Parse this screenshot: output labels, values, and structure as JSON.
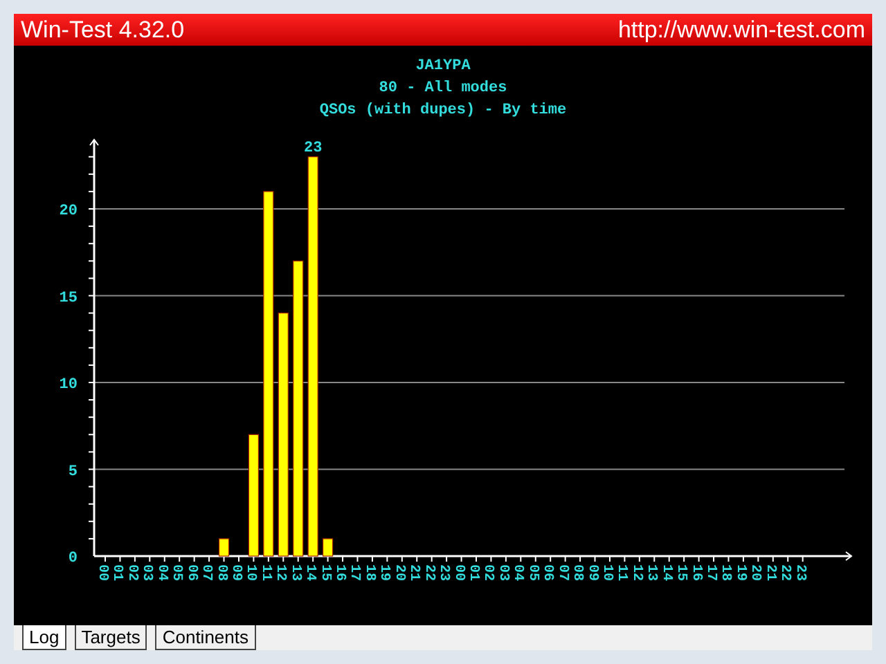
{
  "window": {
    "title": "Win-Test 4.32.0",
    "url": "http://www.win-test.com"
  },
  "chart": {
    "titles": [
      "JA1YPA",
      "80 - All modes",
      "QSOs (with dupes) - By time"
    ],
    "chart_data": {
      "type": "bar",
      "grid": true,
      "categories": [
        "00",
        "01",
        "02",
        "03",
        "04",
        "05",
        "06",
        "07",
        "08",
        "09",
        "10",
        "11",
        "12",
        "13",
        "14",
        "15",
        "16",
        "17",
        "18",
        "19",
        "20",
        "21",
        "22",
        "23",
        "00",
        "01",
        "02",
        "03",
        "04",
        "05",
        "06",
        "07",
        "08",
        "09",
        "10",
        "11",
        "12",
        "13",
        "14",
        "15",
        "16",
        "17",
        "18",
        "19",
        "20",
        "21",
        "22",
        "23"
      ],
      "series": [
        {
          "color": "#ffff00",
          "values": [
            0,
            0,
            0,
            0,
            0,
            0,
            0,
            0,
            1,
            0,
            7,
            21,
            14,
            17,
            23,
            1,
            0,
            0,
            0,
            0,
            0,
            0,
            0,
            0,
            0,
            0,
            0,
            0,
            0,
            0,
            0,
            0,
            0,
            0,
            0,
            0,
            0,
            0,
            0,
            0,
            0,
            0,
            0,
            0,
            0,
            0,
            0,
            0
          ]
        }
      ],
      "ylim": [
        0,
        24
      ],
      "yticks": [
        0,
        5,
        10,
        15,
        20
      ],
      "value_labels": [
        null,
        null,
        null,
        null,
        null,
        null,
        null,
        null,
        null,
        null,
        null,
        null,
        null,
        null,
        "23",
        null,
        null,
        null,
        null,
        null,
        null,
        null,
        null,
        null,
        null,
        null,
        null,
        null,
        null,
        null,
        null,
        null,
        null,
        null,
        null,
        null,
        null,
        null,
        null,
        null,
        null,
        null,
        null,
        null,
        null,
        null,
        null,
        null
      ]
    }
  },
  "tabs": [
    {
      "label": "Log",
      "selected": true
    },
    {
      "label": "Targets",
      "selected": false
    },
    {
      "label": "Continents",
      "selected": false
    }
  ]
}
